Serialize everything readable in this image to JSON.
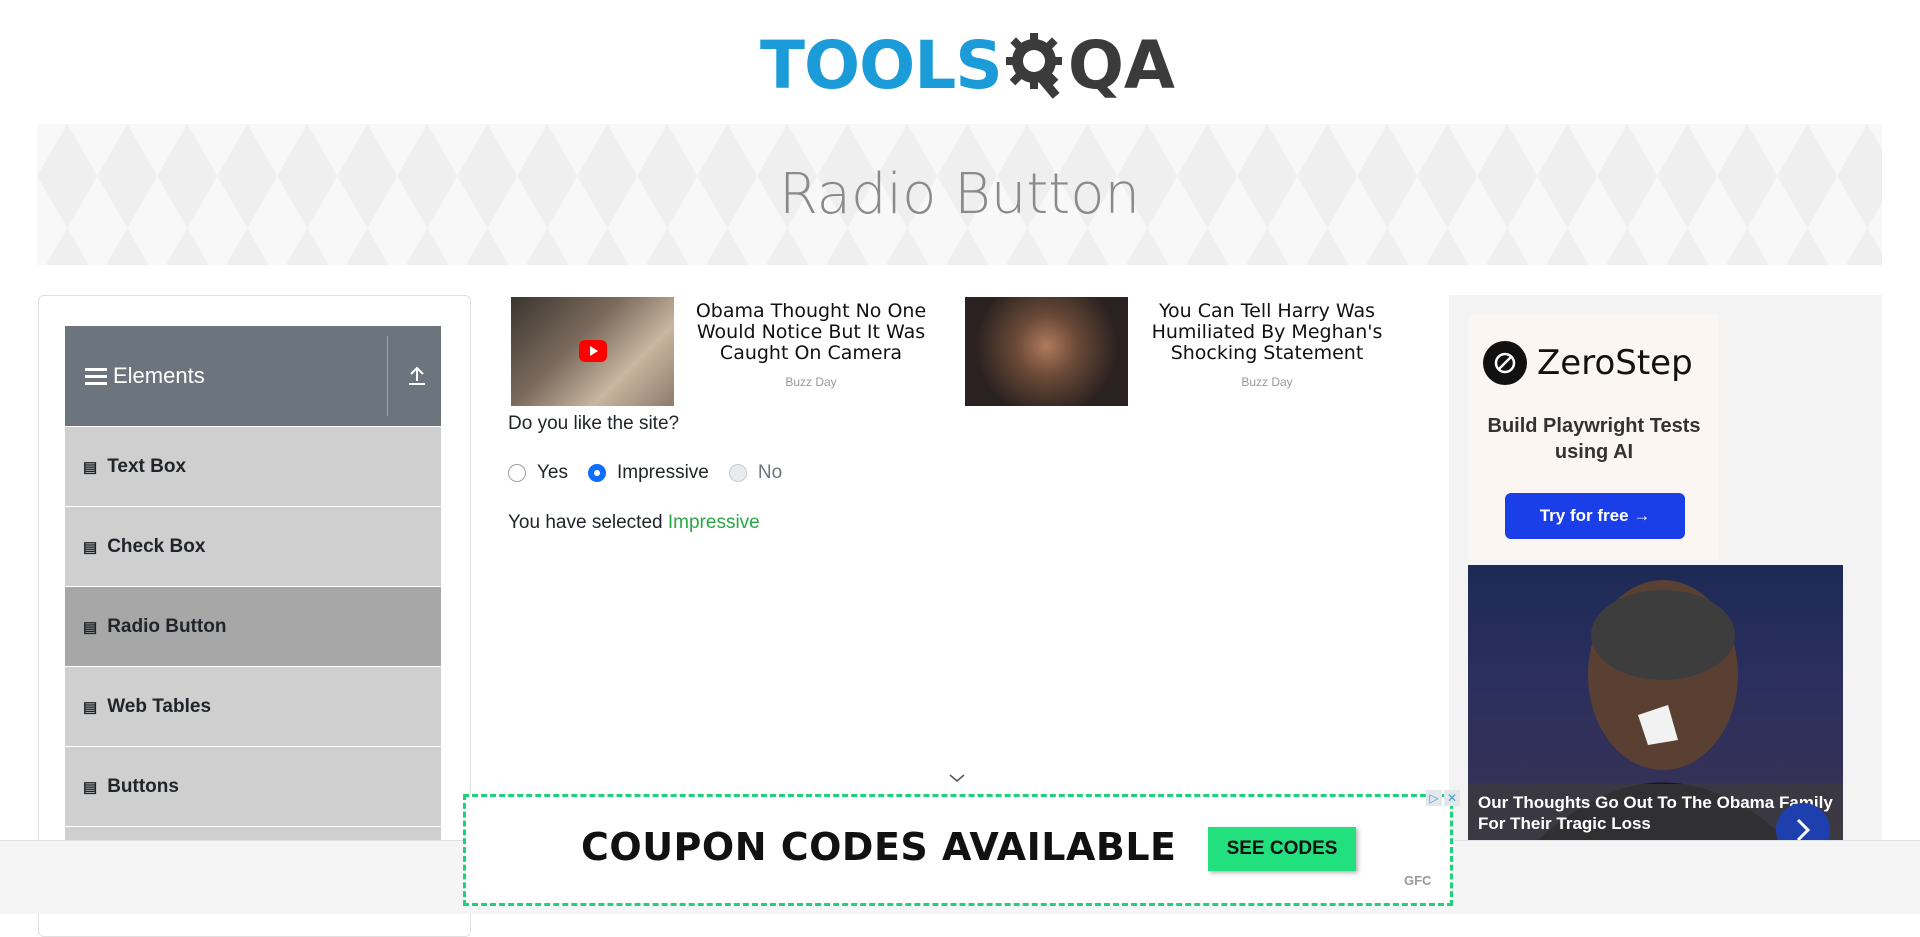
{
  "header": {
    "logo_main": "TOOLS",
    "logo_qa": "QA"
  },
  "banner": {
    "title": "Radio Button"
  },
  "sidebar": {
    "group_title": "Elements",
    "items": [
      {
        "label": "Text Box"
      },
      {
        "label": "Check Box"
      },
      {
        "label": "Radio Button",
        "active": true
      },
      {
        "label": "Web Tables"
      },
      {
        "label": "Buttons"
      }
    ]
  },
  "ads": {
    "cards": [
      {
        "title": "Obama Thought No One Would Notice But It Was Caught On Camera",
        "source": "Buzz Day"
      },
      {
        "title": "You Can Tell Harry Was Humiliated By Meghan's Shocking Statement",
        "source": "Buzz Day"
      }
    ],
    "zerostep": {
      "brand": "ZeroStep",
      "tagline": "Build Playwright Tests using AI",
      "cta": "Try for free →"
    },
    "side_story": {
      "caption": "Our Thoughts Go Out To The Obama Family For Their Tragic Loss"
    },
    "coupon": {
      "text": "COUPON CODES AVAILABLE",
      "cta": "SEE CODES",
      "brand": "GFC"
    }
  },
  "form": {
    "question": "Do you like the site?",
    "options": [
      {
        "label": "Yes",
        "checked": false,
        "disabled": false
      },
      {
        "label": "Impressive",
        "checked": true,
        "disabled": false
      },
      {
        "label": "No",
        "checked": false,
        "disabled": true
      }
    ],
    "result_prefix": "You have selected",
    "result_value": "Impressive"
  },
  "colors": {
    "accent": "#0d6efd",
    "success": "#28a745",
    "logo_blue": "#1b9bd7",
    "header_gray": "#6c757d"
  }
}
